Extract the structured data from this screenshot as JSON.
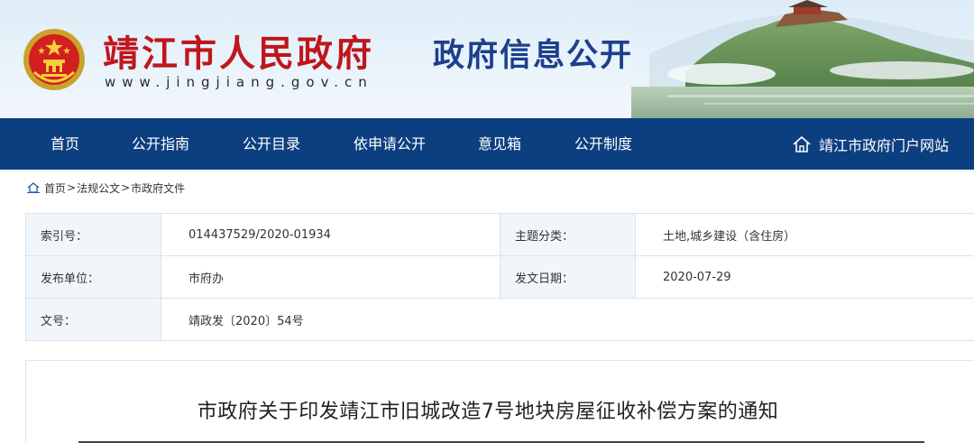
{
  "header": {
    "site_title": "靖江市人民政府",
    "site_url": "www.jingjiang.gov.cn",
    "section_title": "政府信息公开"
  },
  "nav": {
    "items": [
      {
        "label": "首页"
      },
      {
        "label": "公开指南"
      },
      {
        "label": "公开目录"
      },
      {
        "label": "依申请公开"
      },
      {
        "label": "意见箱"
      },
      {
        "label": "公开制度"
      }
    ],
    "portal_label": "靖江市政府门户网站"
  },
  "breadcrumb": {
    "items": [
      "首页",
      "法规公文",
      "市政府文件"
    ],
    "separator": ">"
  },
  "info": {
    "index_label": "索引号：",
    "index_value": "014437529/2020-01934",
    "topic_label": "主题分类：",
    "topic_value": "土地,城乡建设（含住房）",
    "publisher_label": "发布单位：",
    "publisher_value": "市府办",
    "date_label": "发文日期：",
    "date_value": "2020-07-29",
    "docno_label": "文号：",
    "docno_value": "靖政发〔2020〕54号"
  },
  "article": {
    "title": "市政府关于印发靖江市旧城改造7号地块房屋征收补偿方案的通知"
  },
  "colors": {
    "title_red": "#c0161d",
    "section_blue": "#1d3f8c",
    "nav_blue": "#0c3f7f",
    "label_cell_bg": "#f1f6fb"
  }
}
